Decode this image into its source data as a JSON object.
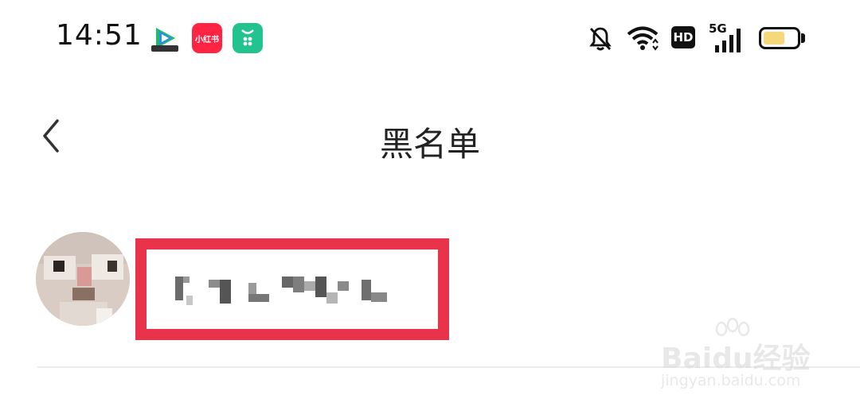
{
  "status_bar": {
    "time": "14:51",
    "apps": [
      {
        "name": "tencent-video",
        "label": ""
      },
      {
        "name": "xiaohongshu",
        "label": "小红书"
      },
      {
        "name": "green-app",
        "label": ""
      }
    ],
    "hd_label": "HD",
    "network_label": "5G",
    "battery_level": 0.65,
    "colors": {
      "xhs": "#ff2442",
      "green_app": "#22c38e",
      "battery": "#f6d77a"
    }
  },
  "header": {
    "title": "黑名单",
    "back_icon": "chevron-left-icon"
  },
  "blacklist": {
    "items": [
      {
        "avatar": "cat-avatar",
        "name_obscured": true
      }
    ],
    "highlight_color": "#e8334a"
  },
  "watermark": {
    "brand": "Baidu经验",
    "url": "jingyan.baidu.com"
  }
}
